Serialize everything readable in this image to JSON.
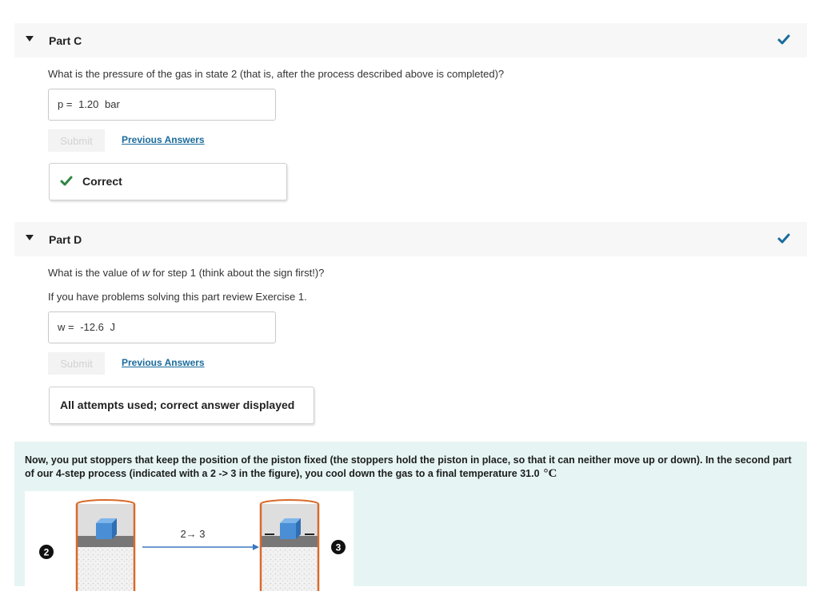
{
  "partC": {
    "title": "Part C",
    "question": "What is the pressure of the gas in state 2 (that is, after the process described above is completed)?",
    "answer_label": "p =",
    "answer_value": "1.20",
    "answer_unit": "bar",
    "submit_label": "Submit",
    "previous_answers_label": "Previous Answers",
    "feedback": "Correct",
    "status_icon": "checkmark-icon",
    "status_color": "#1a6b9c",
    "feedback_color": "#2e8540"
  },
  "partD": {
    "title": "Part D",
    "question_pre": "What is the value of ",
    "question_var": "w",
    "question_post": " for step 1 (think about the sign first!)?",
    "hint": "If you have problems solving this part review Exercise 1.",
    "answer_label": "w =",
    "answer_value": "-12.6",
    "answer_unit": "J",
    "submit_label": "Submit",
    "previous_answers_label": "Previous Answers",
    "feedback": "All attempts used; correct answer displayed",
    "status_icon": "checkmark-icon",
    "status_color": "#1a6b9c"
  },
  "context": {
    "text_pre": "Now, you put stoppers that keep the position of the piston fixed (the stoppers hold the piston in place, so that it can neither move up or down). In the second part of our 4-step process (indicated with a 2 -> 3 in the figure), you cool down the gas to a final temperature  ",
    "temperature_value": "31.0",
    "temperature_unit": "°C",
    "background_color": "#e6f5f4"
  },
  "figure": {
    "state_left": "2",
    "state_right": "3",
    "arrow_label": "2→ 3",
    "cylinder_color": "#d86a2b",
    "block_color": "#4a8fd6",
    "piston_color": "#777777",
    "arrow_color": "#3b78c2"
  }
}
